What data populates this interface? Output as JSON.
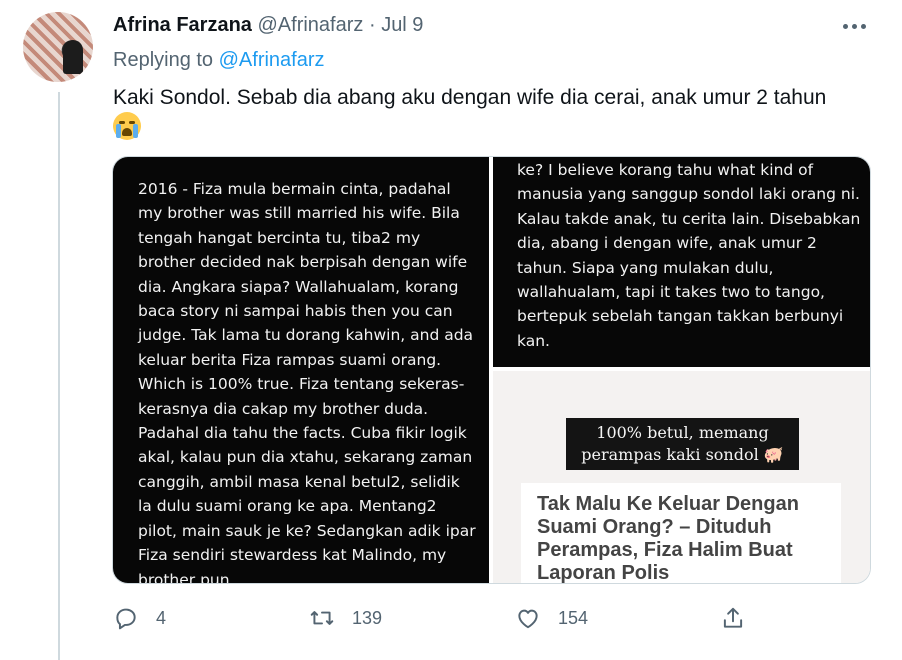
{
  "tweet": {
    "display_name": "Afrina Farzana",
    "handle": "@Afrinafarz",
    "separator": "·",
    "date": "Jul 9",
    "replying_label": "Replying to",
    "replying_to": "@Afrinafarz",
    "text": "Kaki Sondol. Sebab dia abang aku dengan wife dia cerai, anak umur 2 tahun",
    "emoji": "loudly-crying-face-emoji"
  },
  "media": {
    "left_text": "2016 - Fiza mula bermain cinta, padahal my brother was still married his wife. Bila tengah hangat bercinta tu, tiba2 my brother decided nak berpisah dengan wife dia. Angkara siapa? Wallahualam, korang baca story ni sampai habis then you can judge. Tak lama tu dorang kahwin, and ada keluar berita Fiza rampas suami orang. Which is 100% true. Fiza tentang sekeras-kerasnya dia cakap my brother duda. Padahal dia tahu the facts. Cuba fikir logik akal, kalau pun dia xtahu, sekarang zaman canggih, ambil masa kenal betul2, selidik la dulu suami orang ke apa. Mentang2 pilot, main sauk je ke? Sedangkan adik ipar Fiza sendiri stewardess kat Malindo, my brother pun",
    "right_top_text": "ke? I believe korang tahu what kind of manusia yang sanggup sondol laki orang ni. Kalau takde anak, tu cerita lain. Disebabkan dia, abang i dengan wife, anak umur 2 tahun. Siapa yang mulakan dulu, wallahualam, tapi it takes two to tango, bertepuk sebelah tangan takkan berbunyi kan.",
    "banner_line1": "100% betul, memang",
    "banner_line2": "perampas kaki sondol 🐖",
    "article_title": "Tak Malu Ke Keluar Dengan Suami Orang? – Dituduh Perampas, Fiza Halim Buat Laporan Polis"
  },
  "actions": {
    "replies": "4",
    "retweets": "139",
    "likes": "154",
    "icons": [
      "reply-icon",
      "retweet-icon",
      "like-icon",
      "share-icon"
    ]
  },
  "colors": {
    "accent": "#1d9bf0",
    "secondary_text": "#536471",
    "border": "#cfd9de"
  }
}
